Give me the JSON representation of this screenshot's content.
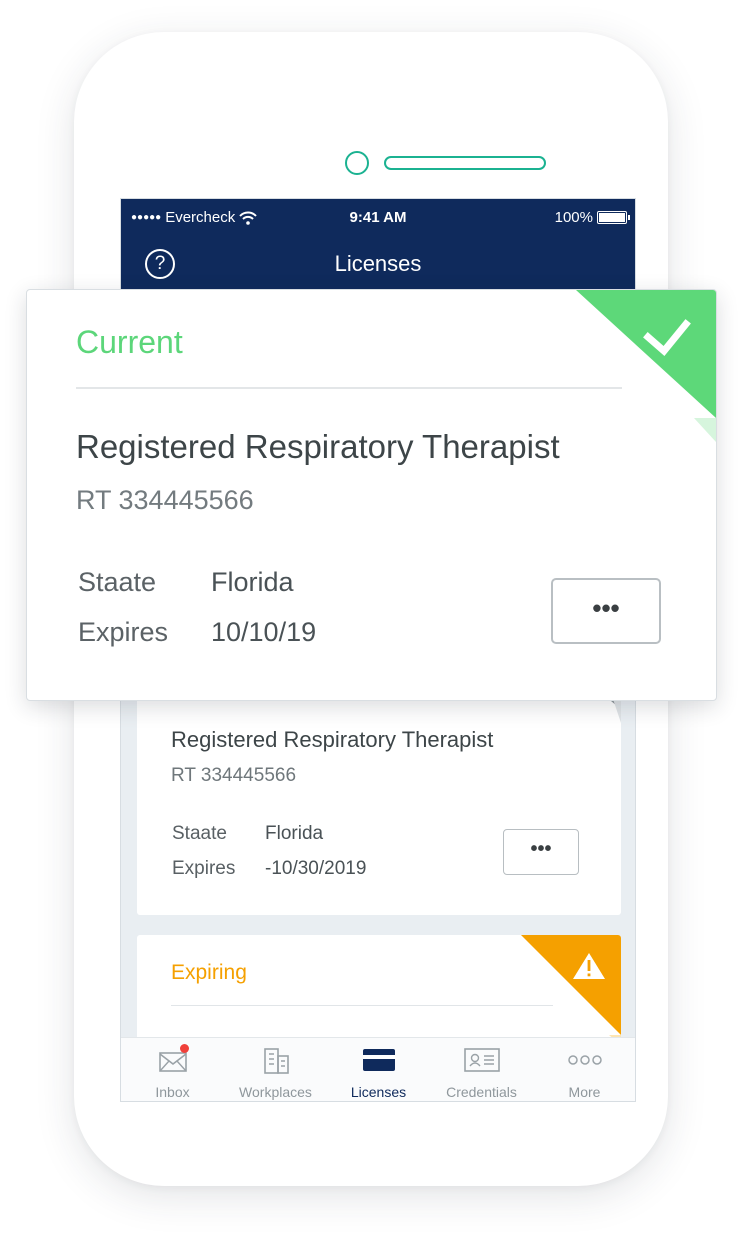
{
  "status_bar": {
    "signal_dots": "●●●●●",
    "carrier": "Evercheck",
    "time": "9:41 AM",
    "battery": "100%"
  },
  "nav": {
    "help_icon": "?",
    "title": "Licenses"
  },
  "featured_license": {
    "status": "Current",
    "status_color": "#5cd67a",
    "name": "Registered Respiratory Therapist",
    "number": "RT 334445566",
    "state_label": "Staate",
    "state_value": "Florida",
    "expires_label": "Expires",
    "expires_value": "10/10/19",
    "more_label": "•••"
  },
  "license_card_2": {
    "name": "Registered Respiratory Therapist",
    "number": "RT 334445566",
    "state_label": "Staate",
    "state_value": "Florida",
    "expires_label": "Expires",
    "expires_value": "-10/30/2019",
    "more_label": "•••"
  },
  "license_card_3": {
    "status": "Expiring",
    "status_color": "#f5a000",
    "alert_icon": "!"
  },
  "tab_bar": {
    "items": [
      {
        "label": "Inbox",
        "icon": "inbox-icon",
        "active": false
      },
      {
        "label": "Workplaces",
        "icon": "building-icon",
        "active": false
      },
      {
        "label": "Licenses",
        "icon": "card-icon",
        "active": true
      },
      {
        "label": "Credentials",
        "icon": "id-card-icon",
        "active": false
      },
      {
        "label": "More",
        "icon": "more-icon",
        "active": false
      }
    ],
    "active_color": "#0f2a5c",
    "inactive_color": "#8f979c"
  }
}
